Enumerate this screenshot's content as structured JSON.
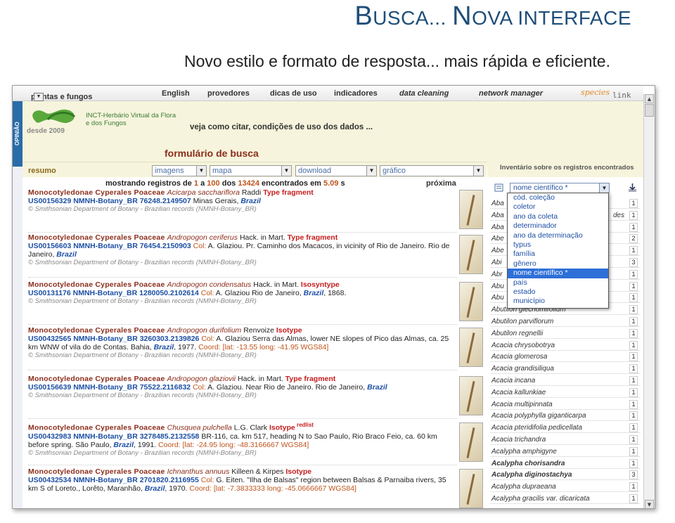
{
  "slide": {
    "title_b": "B",
    "title_usca": "USCA... ",
    "title_n": "N",
    "title_ova": "OVA INTERFACE",
    "subtitle": "Novo estilo e formato de resposta... mais rápida e eficiente."
  },
  "topnav": {
    "plantas": "plantas e fungos",
    "english": "English",
    "provedores": "provedores",
    "dicas": "dicas de uso",
    "indicadores": "indicadores",
    "cleaning": "data cleaning",
    "network": "network manager",
    "species": "species",
    "link": "link"
  },
  "header": {
    "opiniao": "OPINIÃO",
    "logo": "INCT-Herbário Virtual da Flora e dos Fungos",
    "desde": "desde 2009",
    "cite": "veja como citar, condições de uso dos dados ...",
    "form": "formulário de busca"
  },
  "toolbar": {
    "resumo": "resumo",
    "imagens": "imagens",
    "mapa": "mapa",
    "download": "download",
    "grafico": "gráfico"
  },
  "results": {
    "prefix": "mostrando registros de",
    "from": "1",
    "a": "a",
    "to": "100",
    "dos": "dos",
    "total": "13424",
    "found": "encontrados em",
    "time": "5.09",
    "s": "s",
    "next": "próxima"
  },
  "records": [
    {
      "tax": "Monocotyledonae Cyperales Poaceae",
      "sp": "Acicarpa sacchariflora",
      "auth": "Raddi",
      "type": "Type fragment",
      "id": "US00156329 NMNH-Botany_BR 76248.2149507",
      "rest": "Minas Gerais,",
      "country": "Brazil",
      "src": "© Smithsonian Department of Botany - Brazilian records (NMNH-Botany_BR)"
    },
    {
      "tax": "Monocotyledonae Cyperales Poaceae",
      "sp": "Andropogon ceriferus",
      "auth": "Hack. in Mart.",
      "type": "Type fragment",
      "id": "US00156603 NMNH-Botany_BR 76454.2150903",
      "col": "Col:",
      "rest": "A. Glaziou. Pr. Caminho dos Macacos, in vicinity of Rio de Janeiro. Rio de Janeiro,",
      "country": "Brazil",
      "src": "© Smithsonian Department of Botany - Brazilian records (NMNH-Botany_BR)"
    },
    {
      "tax": "Monocotyledonae Cyperales Poaceae",
      "sp": "Andropogon condensatus",
      "auth": "Hack. in Mart.",
      "type": "Isosyntype",
      "id": "US00131176 NMNH-Botany_BR 1280050.2102614",
      "col": "Col:",
      "rest": "A. Glaziou Rio de Janeiro,",
      "country": "Brazil",
      "year": ", 1868.",
      "src": "© Smithsonian Department of Botany - Brazilian records (NMNH-Botany_BR)"
    },
    {
      "tax": "Monocotyledonae Cyperales Poaceae",
      "sp": "Andropogon durifolium",
      "auth": "Renvoize",
      "type": "Isotype",
      "id": "US00432565 NMNH-Botany_BR 3260303.2139826",
      "col": "Col:",
      "rest": "A. Glaziou",
      "rest2": "Serra das Almas, lower NE slopes of Pico das Almas, ca. 25 km WNW of vila do de Contas. Bahia,",
      "country": "Brazil",
      "year": ", 1977.",
      "coord": "Coord: [lat: -13.55 long: -41.95 WGS84]",
      "src": "© Smithsonian Department of Botany - Brazilian records (NMNH-Botany_BR)"
    },
    {
      "tax": "Monocotyledonae Cyperales Poaceae",
      "sp": "Andropogon glaziovii",
      "auth": "Hack. in Mart.",
      "type": "Type fragment",
      "id": "US00156639 NMNH-Botany_BR 75522.2116832",
      "col": "Col:",
      "rest": "A. Glaziou. Near Rio de Janeiro. Rio de Janeiro,",
      "country": "Brazil",
      "src": "© Smithsonian Department of Botany - Brazilian records (NMNH-Botany_BR)"
    },
    {
      "tax": "Monocotyledonae Cyperales Poaceae",
      "sp": "Chusquea pulchella",
      "auth": "L.G. Clark",
      "type": "Isotype",
      "redlist": "redlist",
      "id": "US00432983 NMNH-Botany_BR 3278485.2132558",
      "rest": "BR-116, ca. km 517, heading N to Sao Paulo, Rio Braco Feio, ca. 60 km before spring. São Paulo,",
      "country": "Brazil",
      "year": ", 1991.",
      "coord": "Coord: [lat: -24.95 long: -48.3166667 WGS84]",
      "src": "© Smithsonian Department of Botany - Brazilian records (NMNH-Botany_BR)"
    },
    {
      "tax": "Monocotyledonae Cyperales Poaceae",
      "sp": "Ichnanthus annuus",
      "auth": "Killeen & Kirpes",
      "type": "Isotype",
      "id": "US00432534 NMNH-Botany_BR 2701820.2116955",
      "col": "Col:",
      "rest": "G. Eiten. \"Ilha de Balsas\" region between Balsas & Parnaiba rivers, 35 km S of Loreto., Lorêto, Maranhão,",
      "country": "Brazil",
      "year": ", 1970.",
      "coord": "Coord: [lat: -7.3833333 long: -45.0666667 WGS84]",
      "src": ""
    }
  ],
  "inventory": {
    "head": "Inventário sobre os registros encontrados",
    "select": "nome científico *",
    "rows": [
      {
        "n": "Aba",
        "c": "1"
      },
      {
        "n": "Aba",
        "c": "1",
        "extra": "des"
      },
      {
        "n": "Aba",
        "c": "1"
      },
      {
        "n": "Abe",
        "c": "2"
      },
      {
        "n": "Abe",
        "c": "1"
      },
      {
        "n": "Abi",
        "c": "3"
      },
      {
        "n": "Abr",
        "c": "1"
      },
      {
        "n": "Abu",
        "c": "1"
      },
      {
        "n": "Abu",
        "c": "1"
      },
      {
        "n": "Abutilon glechomifolium",
        "c": "1"
      },
      {
        "n": "Abutilon parviflorum",
        "c": "1"
      },
      {
        "n": "Abutilon regnellii",
        "c": "1"
      },
      {
        "n": "Acacia chrysobotrya",
        "c": "1"
      },
      {
        "n": "Acacia glomerosa",
        "c": "1"
      },
      {
        "n": "Acacia grandisiliqua",
        "c": "1"
      },
      {
        "n": "Acacia incana",
        "c": "1"
      },
      {
        "n": "Acacia kallunkiae",
        "c": "1"
      },
      {
        "n": "Acacia multipinnata",
        "c": "1"
      },
      {
        "n": "Acacia polyphylla giganticarpa",
        "c": "1"
      },
      {
        "n": "Acacia pteridifolia pedicellata",
        "c": "1"
      },
      {
        "n": "Acacia trichandra",
        "c": "1"
      },
      {
        "n": "Acalypha amphigyne",
        "c": "1"
      },
      {
        "n": "Acalypha chorisandra",
        "c": "1",
        "bold": true
      },
      {
        "n": "Acalypha diginostachya",
        "c": "3",
        "bold": true
      },
      {
        "n": "Acalypha dupraeana",
        "c": "1"
      },
      {
        "n": "Acalypha gracilis var. dicaricata",
        "c": "1"
      }
    ],
    "dropdown": [
      "cód. coleção",
      "coletor",
      "ano da coleta",
      "determinador",
      "ano da determinação",
      "typus",
      "família",
      "gênero",
      "nome científico *",
      "país",
      "estado",
      "município"
    ],
    "highlight": "nome científico *"
  }
}
